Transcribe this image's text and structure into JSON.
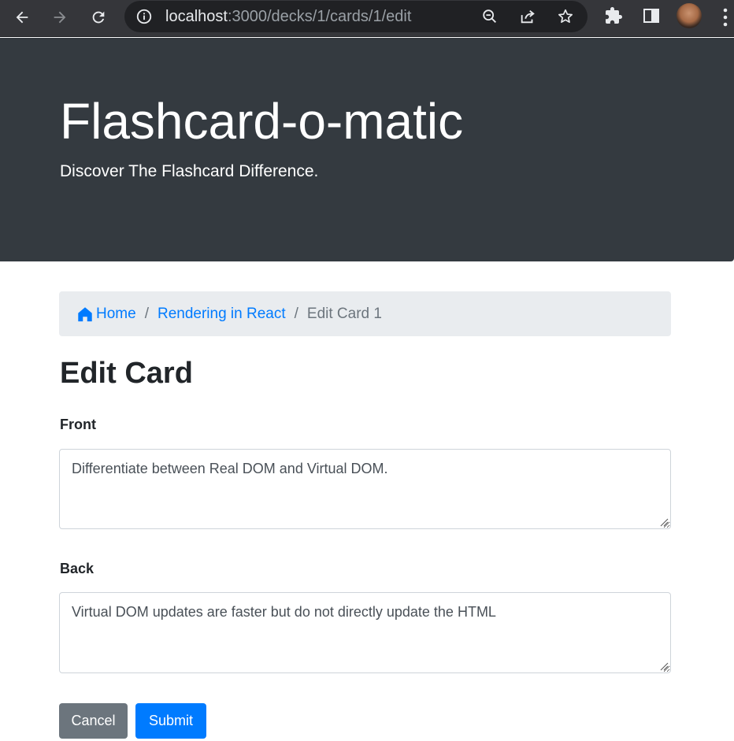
{
  "browser": {
    "url_host": "localhost",
    "url_path": ":3000/decks/1/cards/1/edit",
    "icons": [
      "back-icon",
      "forward-icon",
      "reload-icon",
      "site-info-icon",
      "zoom-icon",
      "share-icon",
      "bookmark-star-icon",
      "extensions-icon",
      "side-panel-icon",
      "profile-avatar",
      "menu-icon"
    ]
  },
  "header": {
    "title": "Flashcard-o-matic",
    "subtitle": "Discover The Flashcard Difference."
  },
  "breadcrumb": {
    "home": "Home",
    "separator": "/",
    "deck": "Rendering in React",
    "current": "Edit Card 1"
  },
  "page": {
    "title": "Edit Card"
  },
  "form": {
    "front_label": "Front",
    "front_value": "Differentiate between Real DOM and Virtual DOM.",
    "back_label": "Back",
    "back_value": "Virtual DOM updates are faster but do not directly update the HTML",
    "cancel_label": "Cancel",
    "submit_label": "Submit"
  },
  "colors": {
    "jumbotron": "#343a40",
    "breadcrumb_bg": "#e9ecef",
    "link": "#007bff",
    "cancel": "#6c757d",
    "submit": "#007bff"
  }
}
